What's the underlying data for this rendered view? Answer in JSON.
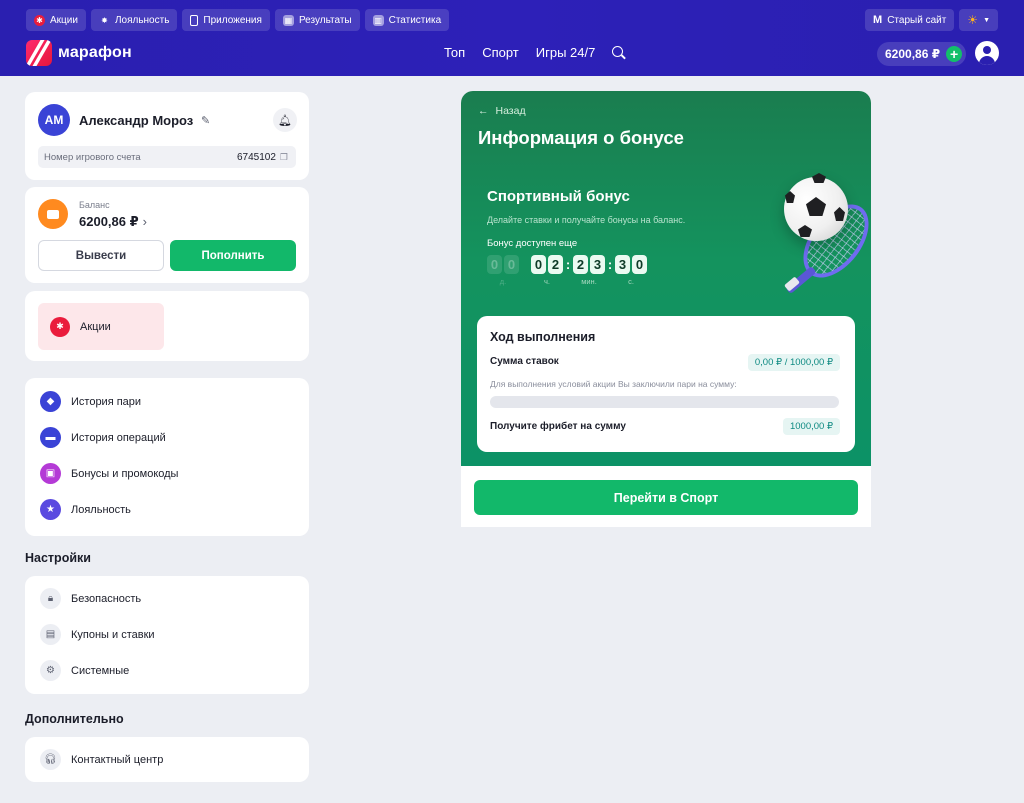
{
  "topbar": {
    "chips": [
      {
        "label": "Акции",
        "icon": "promo-icon",
        "color": "#ea1c3c"
      },
      {
        "label": "Лояльность",
        "icon": "star-icon",
        "color": "#ffffff"
      },
      {
        "label": "Приложения",
        "icon": "phone-icon",
        "color": "#ffffff"
      },
      {
        "label": "Результаты",
        "icon": "results-icon",
        "color": "#ffffff"
      },
      {
        "label": "Статистика",
        "icon": "stats-icon",
        "color": "#ffffff"
      }
    ],
    "old_site": "Старый сайт",
    "theme_icon": "sun-icon"
  },
  "header": {
    "logo_text": "марафон",
    "nav": [
      "Топ",
      "Спорт",
      "Игры 24/7"
    ],
    "balance": "6200,86 ₽"
  },
  "profile": {
    "initials": "АМ",
    "name": "Александр  Мороз",
    "account_label": "Номер игрового счета",
    "account_number": "6745102"
  },
  "balance_card": {
    "label": "Баланс",
    "value": "6200,86 ₽",
    "withdraw": "Вывести",
    "deposit": "Пополнить"
  },
  "promo": {
    "label": "Акции"
  },
  "menu": [
    {
      "label": "История пари",
      "icon": "ticket-icon",
      "color": "#3a43d6"
    },
    {
      "label": "История операций",
      "icon": "wallet-icon",
      "color": "#3a43d6"
    },
    {
      "label": "Бонусы и промокоды",
      "icon": "gift-icon",
      "color": "#b43ad6"
    },
    {
      "label": "Лояльность",
      "icon": "star-icon",
      "color": "#5a4ae0"
    }
  ],
  "settings": {
    "title": "Настройки",
    "items": [
      {
        "label": "Безопасность",
        "icon": "lock-icon"
      },
      {
        "label": "Купоны и ставки",
        "icon": "coupon-icon"
      },
      {
        "label": "Системные",
        "icon": "gear-icon"
      }
    ]
  },
  "extra": {
    "title": "Дополнительно",
    "items": [
      {
        "label": "Контактный центр",
        "icon": "headset-icon"
      }
    ]
  },
  "bonus": {
    "back": "Назад",
    "title": "Информация о бонусе",
    "bonus_name": "Спортивный бонус",
    "subtitle": "Делайте ставки и получайте бонусы на баланс.",
    "available_label": "Бонус доступен еще",
    "timer": [
      {
        "digits": [
          "0",
          "0"
        ],
        "unit": "д.",
        "dim": true
      },
      {
        "digits": [
          "0",
          "2"
        ],
        "unit": "ч.",
        "dim": false
      },
      {
        "digits": [
          "2",
          "3"
        ],
        "unit": "мин.",
        "dim": false
      },
      {
        "digits": [
          "3",
          "0"
        ],
        "unit": "с.",
        "dim": false
      }
    ],
    "progress_title": "Ход выполнения",
    "bets_label": "Сумма ставок",
    "bets_value": "0,00 ₽ / 1000,00 ₽",
    "progress_note": "Для выполнения условий акции Вы заключили пари на сумму:",
    "progress_fraction": 0,
    "freebet_label": "Получите фрибет на сумму",
    "freebet_value": "1000,00 ₽",
    "cta": "Перейти в Спорт"
  },
  "colors": {
    "header": "#2a1fb0",
    "green": "#12b86a",
    "accent_red": "#ea1c3c"
  }
}
